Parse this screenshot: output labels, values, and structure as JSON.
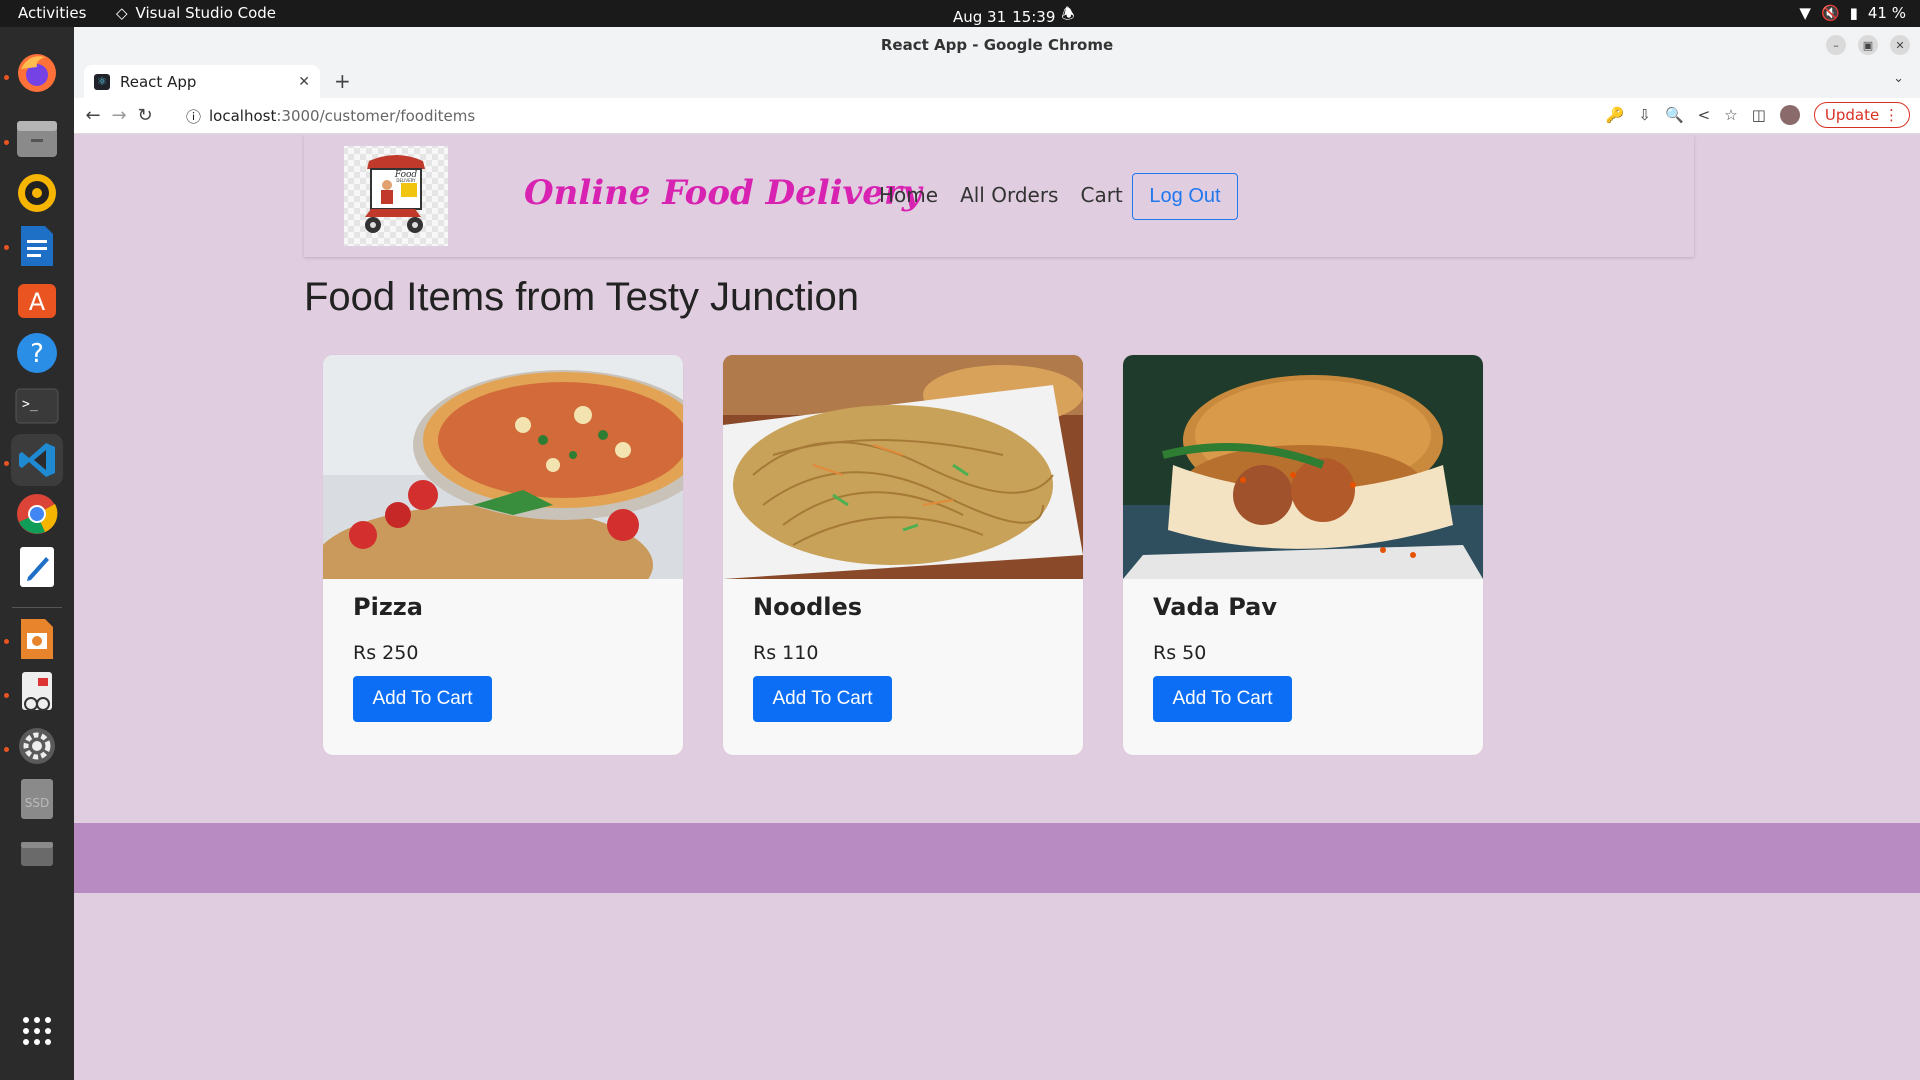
{
  "topbar": {
    "activities": "Activities",
    "app": "Visual Studio Code",
    "date": "Aug 31",
    "time": "15:39",
    "battery": "41 %"
  },
  "dock": {
    "items": [
      "firefox-icon",
      "files-icon",
      "rhythmbox-icon",
      "writer-icon",
      "software-icon",
      "help-icon",
      "terminal-icon",
      "vscode-icon",
      "chrome-icon",
      "text-editor-icon",
      "impress-icon",
      "document-viewer-icon",
      "settings-icon",
      "ssd-drive-icon",
      "trash-icon",
      "app-grid-icon"
    ]
  },
  "window": {
    "title": "React App - Google Chrome"
  },
  "tab": {
    "label": "React App"
  },
  "address": {
    "host": "localhost",
    "path": ":3000/customer/fooditems"
  },
  "toolbar": {
    "update_label": "Update"
  },
  "navbar": {
    "brand": "Online Food Delivery",
    "logo_text_1": "Food",
    "logo_text_2": "DELIVERY",
    "links": [
      "Home",
      "All Orders",
      "Cart"
    ],
    "logout": "Log Out"
  },
  "page": {
    "heading": "Food Items from Testy Junction"
  },
  "items": [
    {
      "name": "Pizza",
      "price": "Rs 250",
      "button": "Add To Cart"
    },
    {
      "name": "Noodles",
      "price": "Rs 110",
      "button": "Add To Cart"
    },
    {
      "name": "Vada Pav",
      "price": "Rs 50",
      "button": "Add To Cart"
    }
  ],
  "colors": {
    "page_bg": "#e0cde0",
    "brand": "#d822b1",
    "primary": "#0b6ef5",
    "footer": "#b98bc3"
  }
}
